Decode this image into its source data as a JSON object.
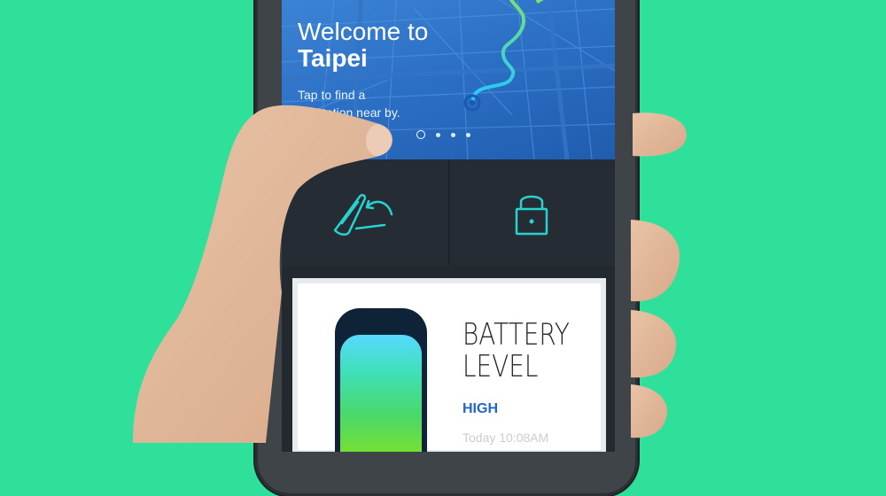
{
  "map": {
    "welcome_line": "Welcome to",
    "city": "Taipei",
    "tap_line_1": "Tap to find a",
    "tap_line_2": "GoStation near by.",
    "carousel": {
      "total": 4,
      "active_index": 0
    }
  },
  "actions": [
    {
      "icon": "scooter-return-icon"
    },
    {
      "icon": "lock-icon"
    }
  ],
  "battery": {
    "title_line_1": "BATTERY",
    "title_line_2": "LEVEL",
    "level": "HIGH",
    "timestamp": "Today 10:08AM"
  },
  "colors": {
    "background": "#2fe09a",
    "map_blue": "#2b6fc4",
    "accent_teal": "#27d3cf",
    "level_blue": "#1f67c4"
  }
}
